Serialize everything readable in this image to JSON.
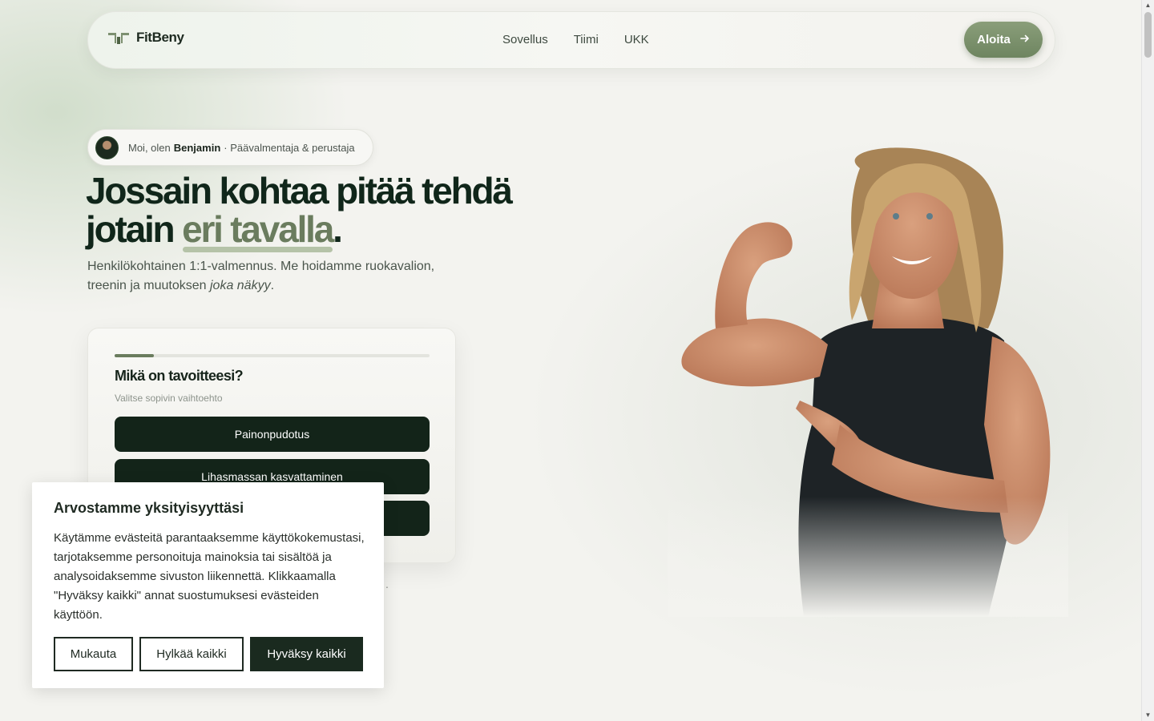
{
  "nav": {
    "brand": "FitBeny",
    "links": [
      "Sovellus",
      "Tiimi",
      "UKK"
    ],
    "cta_label": "Aloita",
    "cta_icon": "arrow-right-icon"
  },
  "intro": {
    "greeting": "Moi, olen",
    "name": "Benjamin",
    "role": "· Päävalmentaja & perustaja"
  },
  "hero": {
    "title_line1": "Jossain kohtaa pitää tehdä",
    "title_line2_start": "jotain",
    "title_highlight": "eri tavalla",
    "title_end": ".",
    "subtitle_start": "Henkilökohtainen 1:1-valmennus. Me hoidamme ruokavalion, treenin ja muutoksen",
    "subtitle_emphasis": "joka näkyy",
    "subtitle_end": "."
  },
  "quiz": {
    "progress": 0.125,
    "question": "Mikä on tavoitteesi?",
    "hint": "Valitse sopivin vaihtoehto",
    "options": [
      "Painonpudotus",
      "Lihasmassan kasvattaminen",
      ""
    ]
  },
  "stray_text": ".",
  "cookie": {
    "title": "Arvostamme yksityisyyttäsi",
    "body": "Käytämme evästeitä parantaaksemme käyttökokemustasi, tarjotaksemme personoituja mainoksia tai sisältöä ja analysoidaksemme sivuston liikennettä. Klikkaamalla \"Hyväksy kaikki\" annat suostumuksesi evästeiden käyttöön.",
    "customize": "Mukauta",
    "reject": "Hylkää kaikki",
    "accept": "Hyväksy kaikki"
  },
  "colors": {
    "accent_green": "#6a7c5e",
    "dark_green": "#132419",
    "background": "#f3f3ef"
  }
}
